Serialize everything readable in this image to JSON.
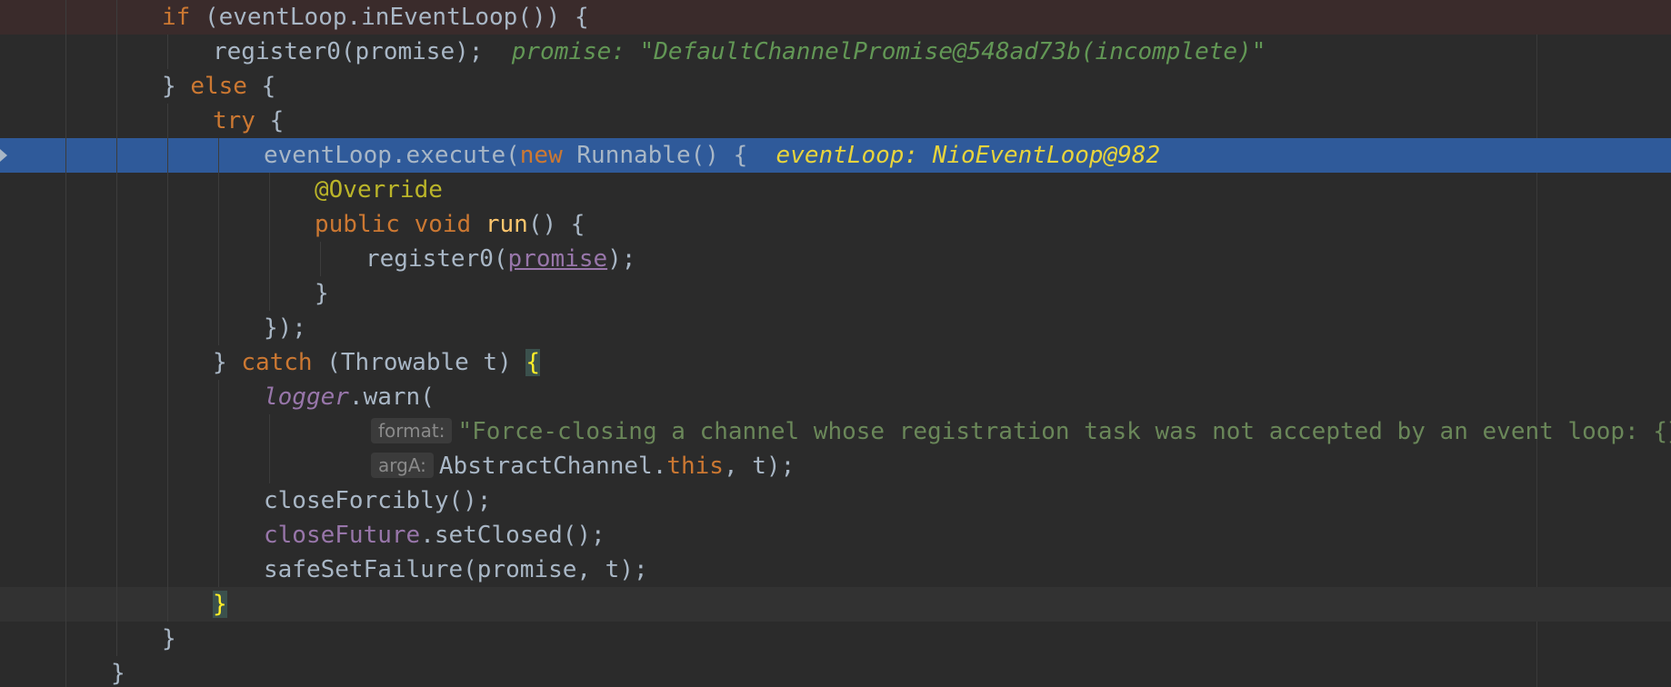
{
  "editor": {
    "lines": [
      {
        "id": "l1",
        "segments": [
          {
            "t": "if",
            "c": "kw"
          },
          {
            "t": " (eventLoop.inEventLoop()) {",
            "c": ""
          }
        ]
      },
      {
        "id": "l2",
        "segments": [
          {
            "t": "register0(promise);",
            "c": ""
          }
        ],
        "hint": "promise: \"DefaultChannelPromise@548ad73b(incomplete)\""
      },
      {
        "id": "l3",
        "segments": [
          {
            "t": "} ",
            "c": ""
          },
          {
            "t": "else",
            "c": "kw"
          },
          {
            "t": " {",
            "c": ""
          }
        ]
      },
      {
        "id": "l4",
        "segments": [
          {
            "t": "try",
            "c": "kw"
          },
          {
            "t": " {",
            "c": ""
          }
        ]
      },
      {
        "id": "l5",
        "segments": [
          {
            "t": "eventLoop.execute(",
            "c": ""
          },
          {
            "t": "new",
            "c": "kw"
          },
          {
            "t": " Runnable() {",
            "c": ""
          }
        ],
        "hint": "eventLoop: NioEventLoop@982"
      },
      {
        "id": "l6",
        "segments": [
          {
            "t": "@Override",
            "c": "ann"
          }
        ]
      },
      {
        "id": "l7",
        "segments": [
          {
            "t": "public",
            "c": "kw"
          },
          {
            "t": " ",
            "c": ""
          },
          {
            "t": "void",
            "c": "kw"
          },
          {
            "t": " ",
            "c": ""
          },
          {
            "t": "run",
            "c": "fn"
          },
          {
            "t": "() {",
            "c": ""
          }
        ]
      },
      {
        "id": "l8",
        "segments": [
          {
            "t": "register0(",
            "c": ""
          },
          {
            "t": "promise",
            "c": "field und"
          },
          {
            "t": ");",
            "c": ""
          }
        ]
      },
      {
        "id": "l9",
        "segments": [
          {
            "t": "}",
            "c": ""
          }
        ]
      },
      {
        "id": "l10",
        "segments": [
          {
            "t": "});",
            "c": ""
          }
        ]
      },
      {
        "id": "l11",
        "segments": [
          {
            "t": "} ",
            "c": ""
          },
          {
            "t": "catch",
            "c": "kw"
          },
          {
            "t": " (Throwable t) ",
            "c": ""
          },
          {
            "t": "{",
            "c": "brace-hl"
          }
        ]
      },
      {
        "id": "l12",
        "segments": [
          {
            "t": "logger",
            "c": "field ital"
          },
          {
            "t": ".warn(",
            "c": ""
          }
        ]
      },
      {
        "id": "l13",
        "param": "format:",
        "segments": [
          {
            "t": "\"Force-closing a channel whose registration task was not accepted by an event loop: {}\"",
            "c": "str"
          },
          {
            "t": ",",
            "c": "kw"
          }
        ]
      },
      {
        "id": "l14",
        "param": "argA:",
        "segments": [
          {
            "t": "AbstractChannel.",
            "c": ""
          },
          {
            "t": "this",
            "c": "kw"
          },
          {
            "t": ", t);",
            "c": ""
          }
        ]
      },
      {
        "id": "l15",
        "segments": [
          {
            "t": "closeForcibly();",
            "c": ""
          }
        ]
      },
      {
        "id": "l16",
        "segments": [
          {
            "t": "closeFuture",
            "c": "field"
          },
          {
            "t": ".setClosed();",
            "c": ""
          }
        ]
      },
      {
        "id": "l17",
        "segments": [
          {
            "t": "safeSetFailure(promise, t);",
            "c": ""
          }
        ]
      },
      {
        "id": "l18",
        "segments": [
          {
            "t": "}",
            "c": "brace-hl"
          }
        ]
      },
      {
        "id": "l19",
        "segments": [
          {
            "t": "}",
            "c": ""
          }
        ]
      },
      {
        "id": "l20",
        "segments": [
          {
            "t": "}",
            "c": ""
          }
        ]
      }
    ],
    "colors": {
      "background": "#2b2b2b",
      "execution_line": "#2f5a9a",
      "keyword": "#cc7832",
      "annotation": "#bbb529",
      "string": "#6a8759",
      "field": "#9876aa",
      "method_decl": "#ffc66d",
      "inline_hint": "#629755",
      "exec_hint": "#e8d43c"
    }
  }
}
